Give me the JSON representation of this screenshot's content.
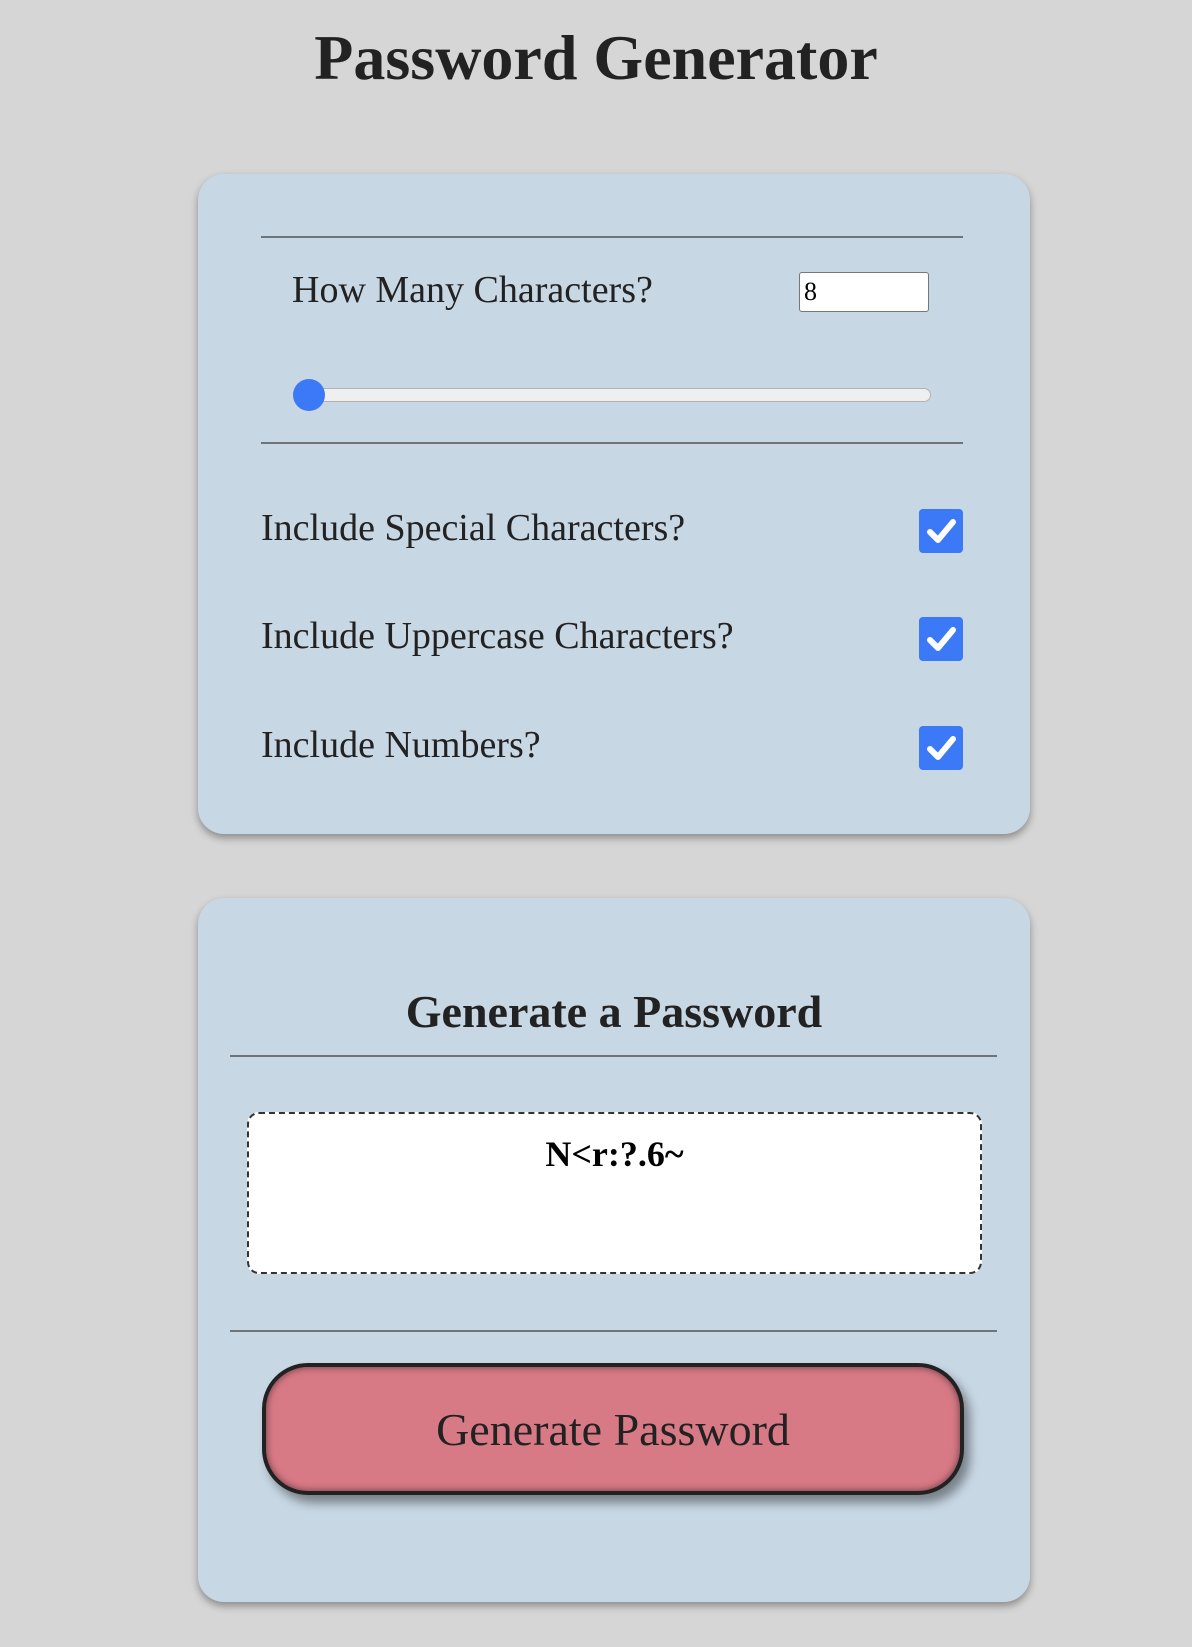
{
  "page": {
    "title": "Password Generator"
  },
  "settings": {
    "length_label": "How Many Characters?",
    "length_value": "8",
    "slider_level": 0,
    "options": [
      {
        "label": "Include Special Characters?",
        "checked": true
      },
      {
        "label": "Include Uppercase Characters?",
        "checked": true
      },
      {
        "label": "Include Numbers?",
        "checked": true
      }
    ]
  },
  "generate": {
    "heading": "Generate a Password",
    "password": "N<r:?.6~",
    "button_label": "Generate Password"
  },
  "colors": {
    "background": "#d6d6d6",
    "card": "#c8d7e4",
    "accent": "#3b79f6",
    "button": "#d87a86"
  },
  "icons": {
    "checkbox": "checkmark-icon"
  }
}
